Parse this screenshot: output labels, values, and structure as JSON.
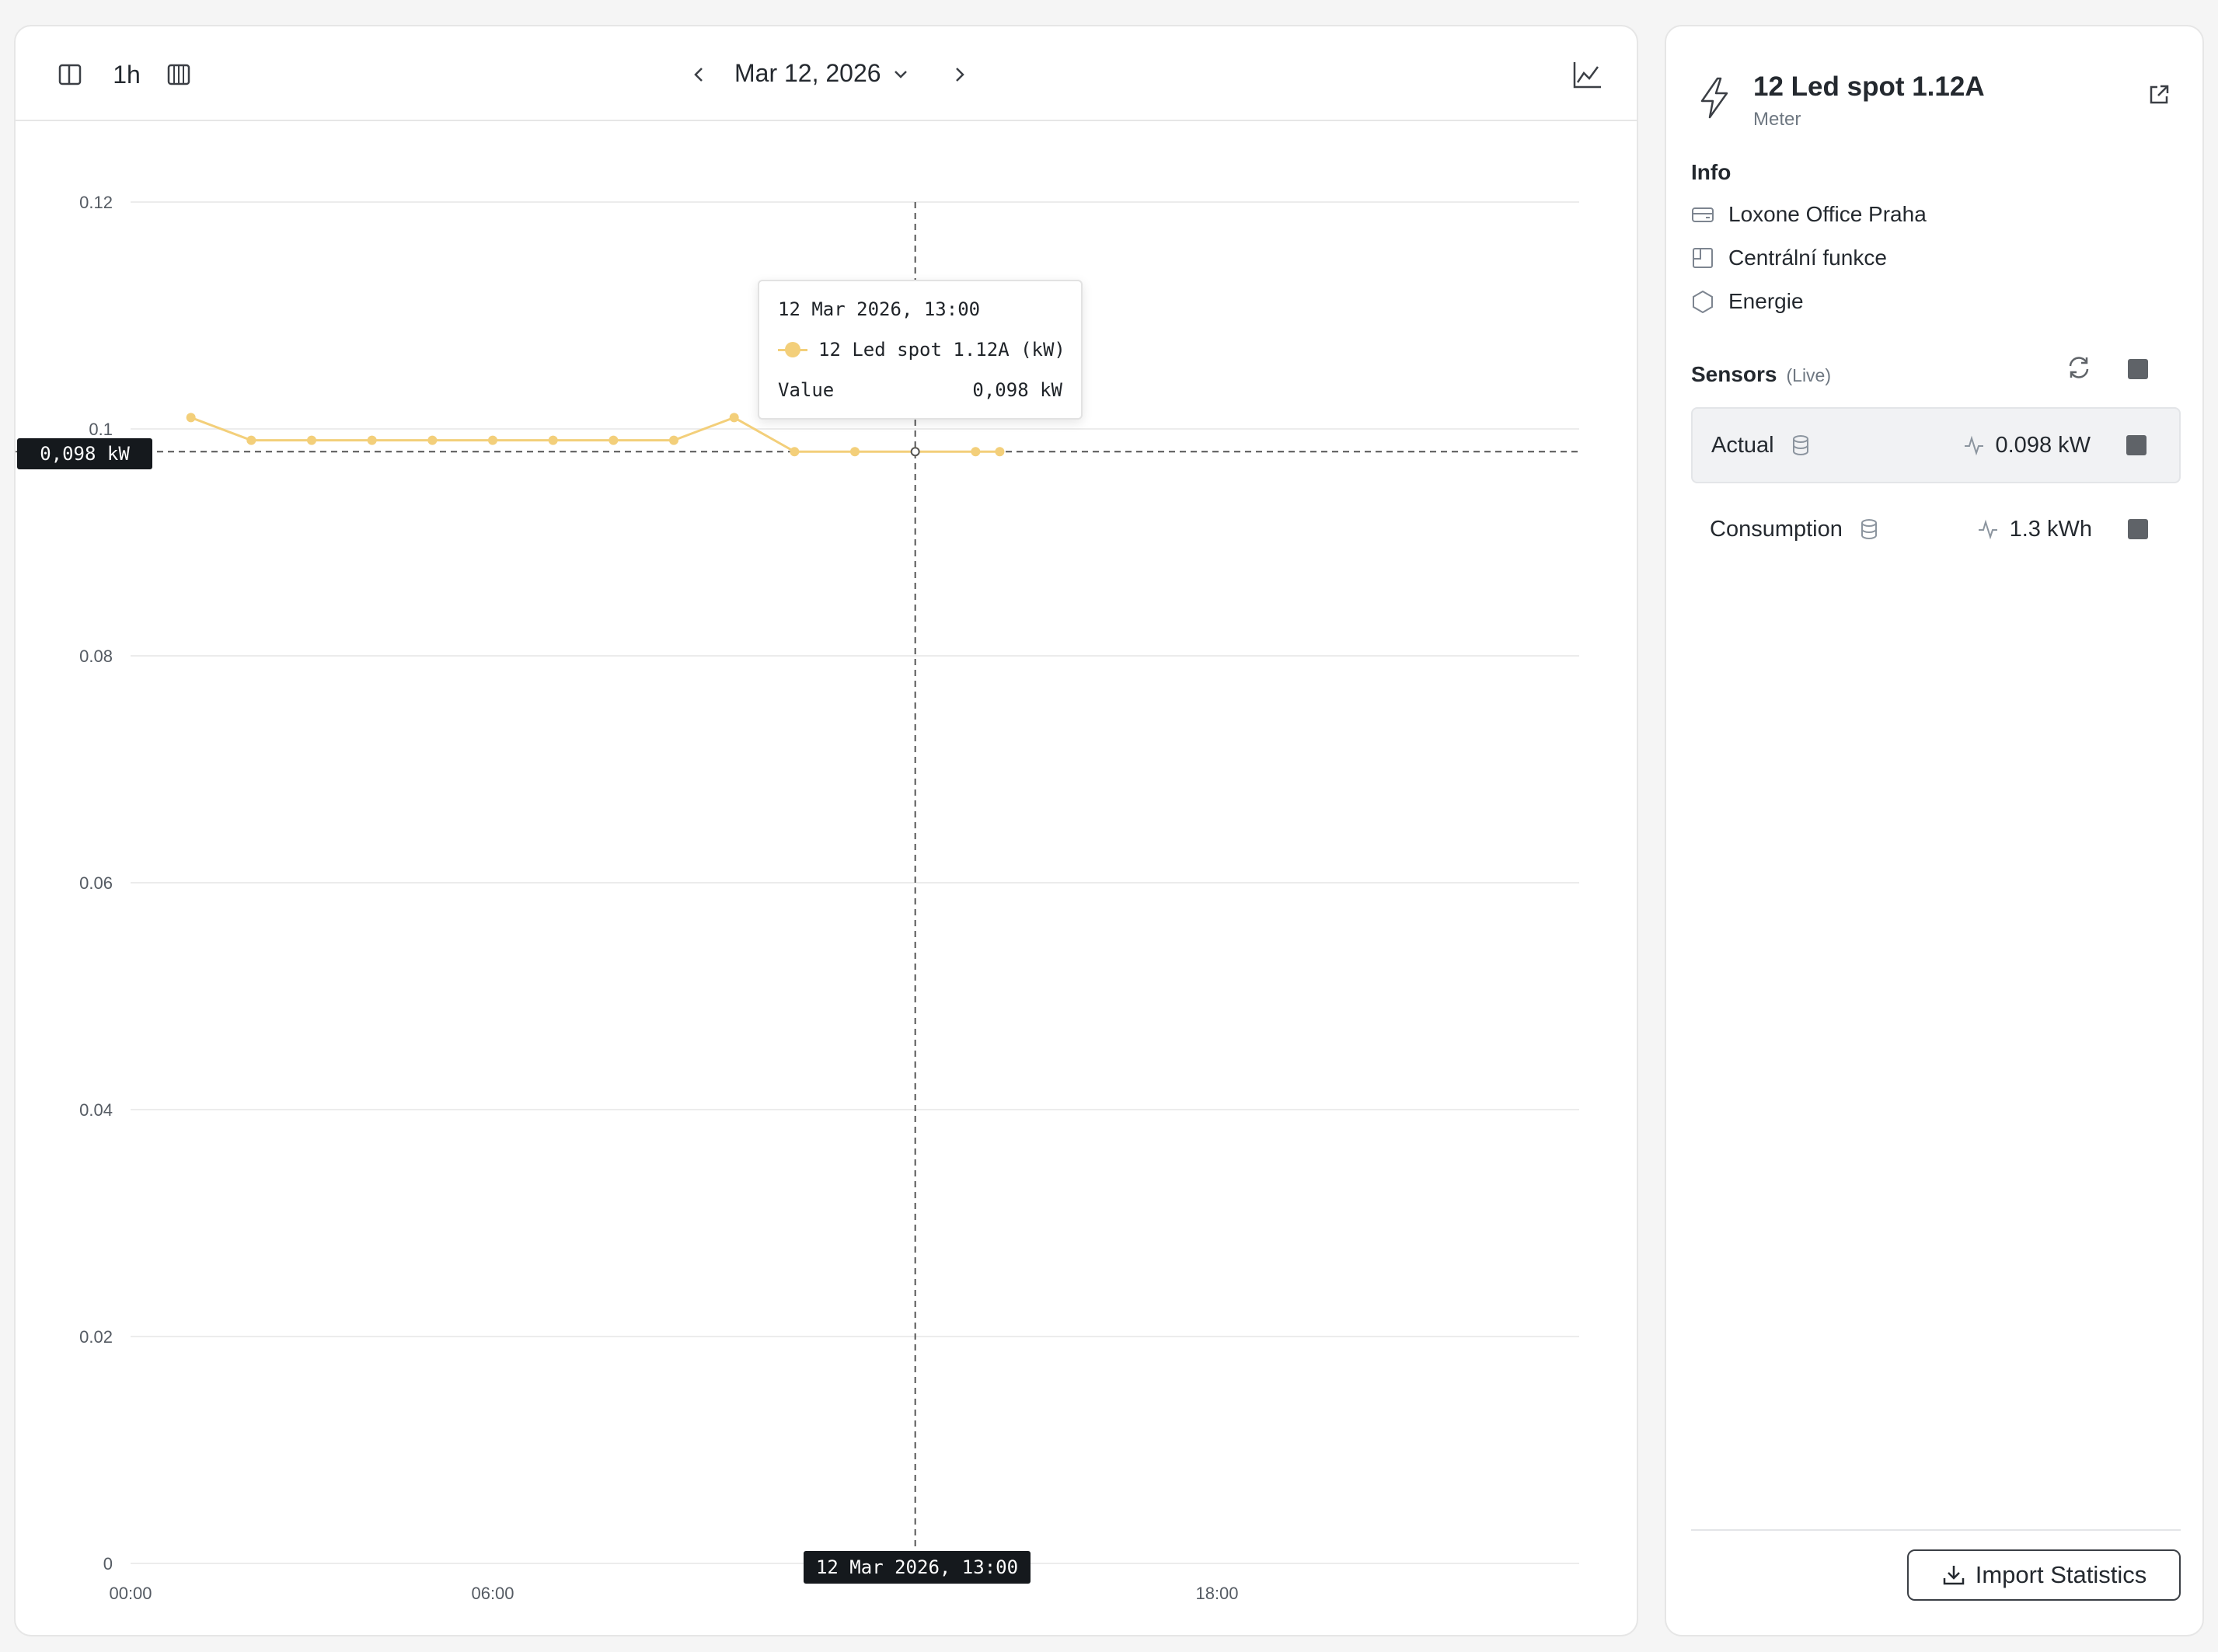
{
  "toolbar": {
    "interval_label": "1h",
    "date_label": "Mar 12, 2026"
  },
  "chart_data": {
    "type": "line",
    "x_type": "time",
    "x_ticks": [
      "00:00",
      "06:00",
      "18:00"
    ],
    "y_ticks": [
      "0.12",
      "0.1",
      "0.08",
      "0.06",
      "0.04",
      "0.02",
      "0"
    ],
    "ylim": [
      0,
      0.12
    ],
    "xlim": [
      "00:00",
      "24:00"
    ],
    "grid": true,
    "series": [
      {
        "name": "12 Led spot 1.12A (kW)",
        "color": "#f3cf7a",
        "x": [
          "01:00",
          "02:00",
          "03:00",
          "04:00",
          "05:00",
          "06:00",
          "07:00",
          "08:00",
          "09:00",
          "10:00",
          "11:00",
          "12:00",
          "13:00",
          "14:00",
          "14:24"
        ],
        "values": [
          0.101,
          0.099,
          0.099,
          0.099,
          0.099,
          0.099,
          0.099,
          0.099,
          0.099,
          0.101,
          0.098,
          0.098,
          0.098,
          0.098,
          0.098
        ]
      }
    ],
    "crosshair": {
      "x": "13:00",
      "y": 0.098,
      "x_label": "12 Mar 2026, 13:00",
      "y_label": "0,098 kW"
    },
    "tooltip": {
      "date": "12 Mar 2026, 13:00",
      "series_label": "12 Led spot 1.12A (kW)",
      "value_label": "Value",
      "value": "0,098 kW"
    }
  },
  "side": {
    "title": "12 Led spot 1.12A",
    "subtitle": "Meter",
    "info_heading": "Info",
    "info_items": [
      {
        "label": "Loxone Office Praha",
        "icon": "server-icon"
      },
      {
        "label": "Centrální funkce",
        "icon": "room-icon"
      },
      {
        "label": "Energie",
        "icon": "hexagon-icon"
      }
    ],
    "sensors_heading": "Sensors",
    "sensors_live": "(Live)",
    "sensors": [
      {
        "name": "Actual",
        "value": "0.098 kW",
        "active": true
      },
      {
        "name": "Consumption",
        "value": "1.3 kWh",
        "active": false
      }
    ],
    "import_label": "Import Statistics"
  }
}
